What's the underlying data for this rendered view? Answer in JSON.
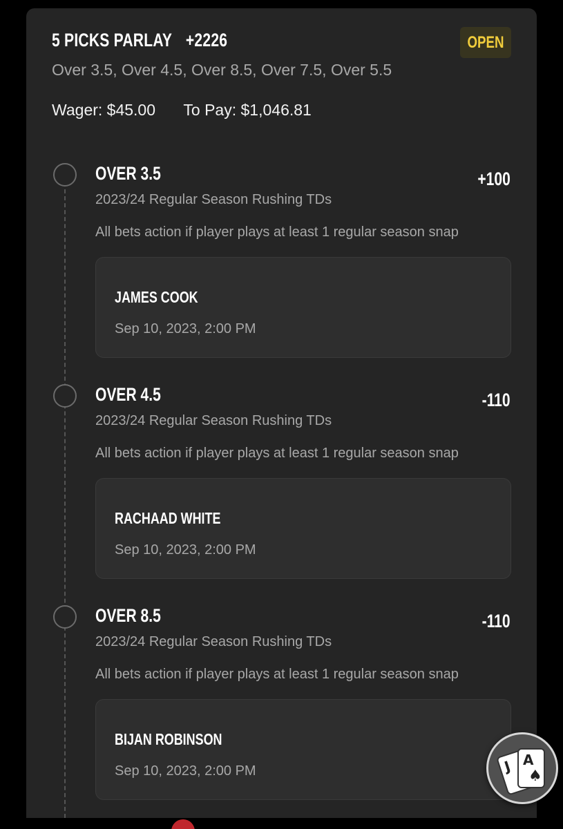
{
  "parlay": {
    "title": "5 PICKS PARLAY",
    "odds": "+2226",
    "status": "OPEN",
    "selections": "Over 3.5, Over 4.5, Over 8.5, Over 7.5, Over 5.5",
    "wager_label": "Wager:",
    "wager_value": "$45.00",
    "pay_label": "To Pay:",
    "pay_value": "$1,046.81"
  },
  "legs": [
    {
      "title": "OVER 3.5",
      "odds": "+100",
      "market": "2023/24 Regular Season Rushing TDs",
      "rule": "All bets action if player plays at least 1 regular season snap",
      "player": "JAMES COOK",
      "time": "Sep 10, 2023, 2:00 PM"
    },
    {
      "title": "OVER 4.5",
      "odds": "-110",
      "market": "2023/24 Regular Season Rushing TDs",
      "rule": "All bets action if player plays at least 1 regular season snap",
      "player": "RACHAAD WHITE",
      "time": "Sep 10, 2023, 2:00 PM"
    },
    {
      "title": "OVER 8.5",
      "odds": "-110",
      "market": "2023/24 Regular Season Rushing TDs",
      "rule": "All bets action if player plays at least 1 regular season snap",
      "player": "BIJAN ROBINSON",
      "time": "Sep 10, 2023, 2:00 PM"
    }
  ],
  "fab": {
    "icon": "playing-cards-icon",
    "card_back": "J",
    "card_front": "A",
    "suit": "♠"
  },
  "colors": {
    "background": "#000000",
    "card": "#252525",
    "status_accent": "#f1cd3c"
  }
}
